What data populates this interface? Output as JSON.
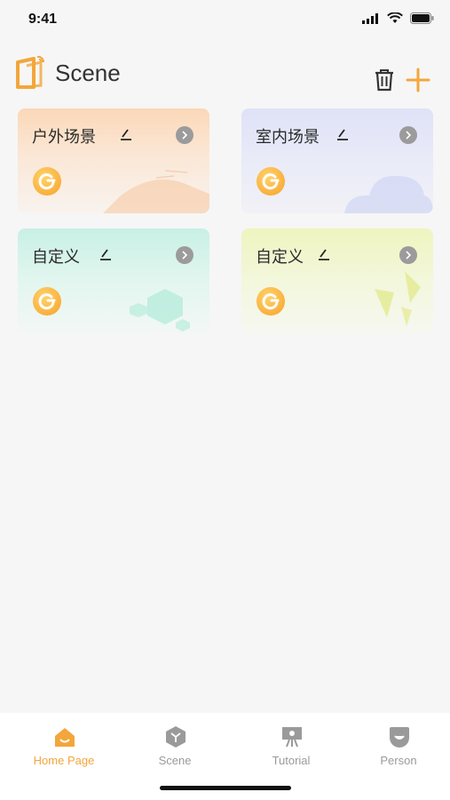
{
  "status_bar": {
    "time": "9:41"
  },
  "header": {
    "title": "Scene"
  },
  "scenes": [
    {
      "name": "户外场景"
    },
    {
      "name": "室内场景"
    },
    {
      "name": "自定义"
    },
    {
      "name": "自定义"
    }
  ],
  "tabbar": {
    "tabs": [
      {
        "label": "Home Page",
        "icon": "home-icon",
        "active": true
      },
      {
        "label": "Scene",
        "icon": "cube-icon",
        "active": false
      },
      {
        "label": "Tutorial",
        "icon": "easel-icon",
        "active": false
      },
      {
        "label": "Person",
        "icon": "person-icon",
        "active": false
      }
    ]
  },
  "colors": {
    "accent": "#f3a63b",
    "inactive": "#9a9a9a",
    "background": "#f6f6f6"
  }
}
